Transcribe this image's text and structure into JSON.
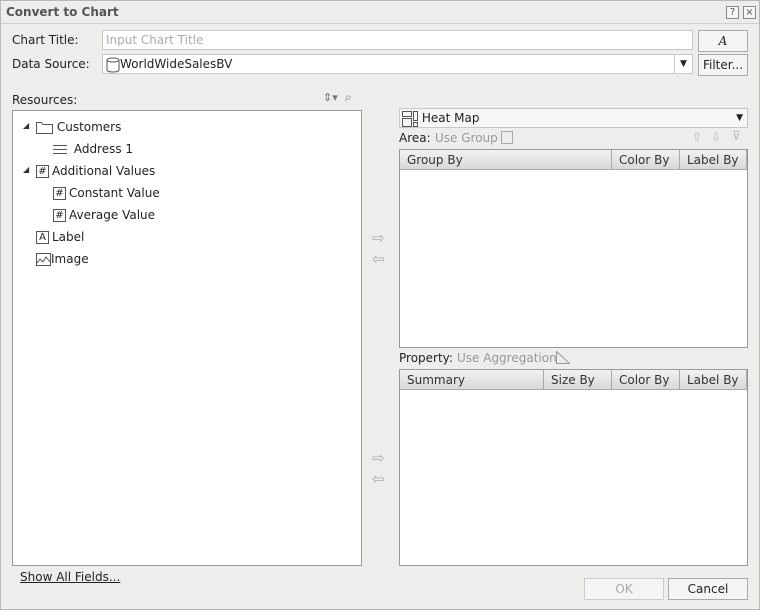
{
  "dialog": {
    "title": "Convert to Chart",
    "help_icon": "?",
    "close_icon": "×"
  },
  "chart_title": {
    "label": "Chart Title:",
    "placeholder": "Input Chart Title",
    "value": "",
    "font_button": "A"
  },
  "data_source": {
    "label": "Data Source:",
    "value": "WorldWideSalesBV",
    "filter_button": "Filter..."
  },
  "resources": {
    "label": "Resources:",
    "items": [
      {
        "label": "Customers",
        "type": "folder",
        "expanded": true
      },
      {
        "label": "Address 1",
        "type": "field"
      },
      {
        "label": "Additional Values",
        "type": "number",
        "expanded": true
      },
      {
        "label": "Constant Value",
        "type": "number"
      },
      {
        "label": "Average Value",
        "type": "number"
      },
      {
        "label": "Label",
        "type": "label"
      },
      {
        "label": "Image",
        "type": "image"
      }
    ]
  },
  "chart_type": {
    "value": "Heat Map"
  },
  "area": {
    "label": "Area:",
    "option": "Use Group",
    "columns": [
      "Group By",
      "Color By",
      "Label By"
    ]
  },
  "property": {
    "label": "Property:",
    "option": "Use Aggregation",
    "columns": [
      "Summary",
      "Size By",
      "Color By",
      "Label By"
    ]
  },
  "footer": {
    "show_all_fields": "Show All Fields...",
    "ok": "OK",
    "cancel": "Cancel"
  }
}
